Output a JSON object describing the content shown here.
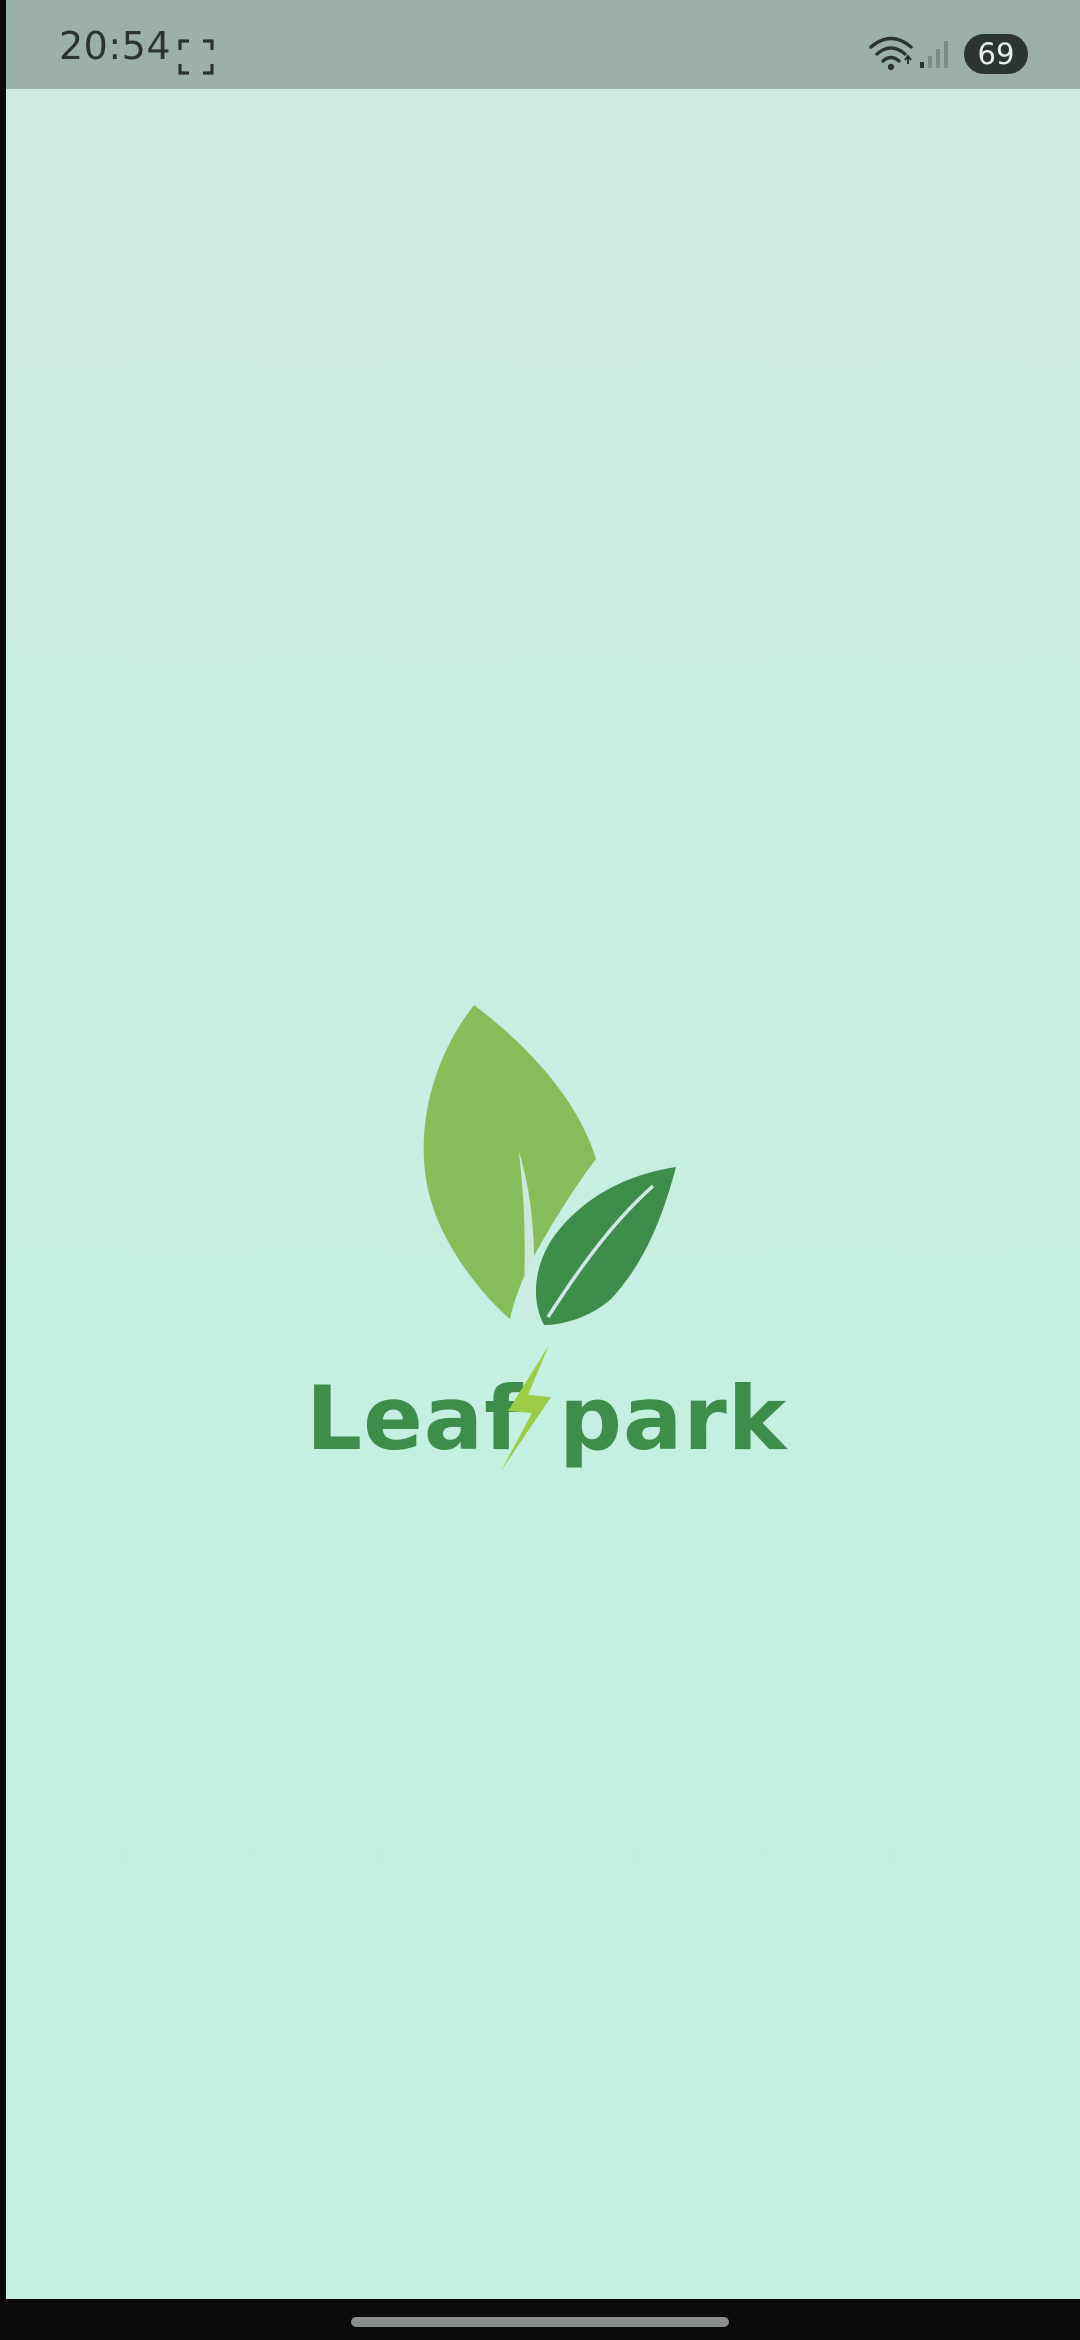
{
  "status_bar": {
    "time": "20:54",
    "battery_level": "69",
    "icons": [
      "screen-record-icon",
      "wifi-icon",
      "signal-icon",
      "battery-icon"
    ]
  },
  "splash": {
    "logo_text": "Leafspark",
    "colors": {
      "light_leaf": "#86bd5a",
      "dark_leaf": "#3f8d4b",
      "wordmark": "#3f8d4b",
      "bolt": "#9ccc45"
    }
  },
  "colors": {
    "status_bar_bg": "#9cb0aa",
    "background_top": "#cfeae3",
    "background_bottom": "#c3f2e0"
  }
}
